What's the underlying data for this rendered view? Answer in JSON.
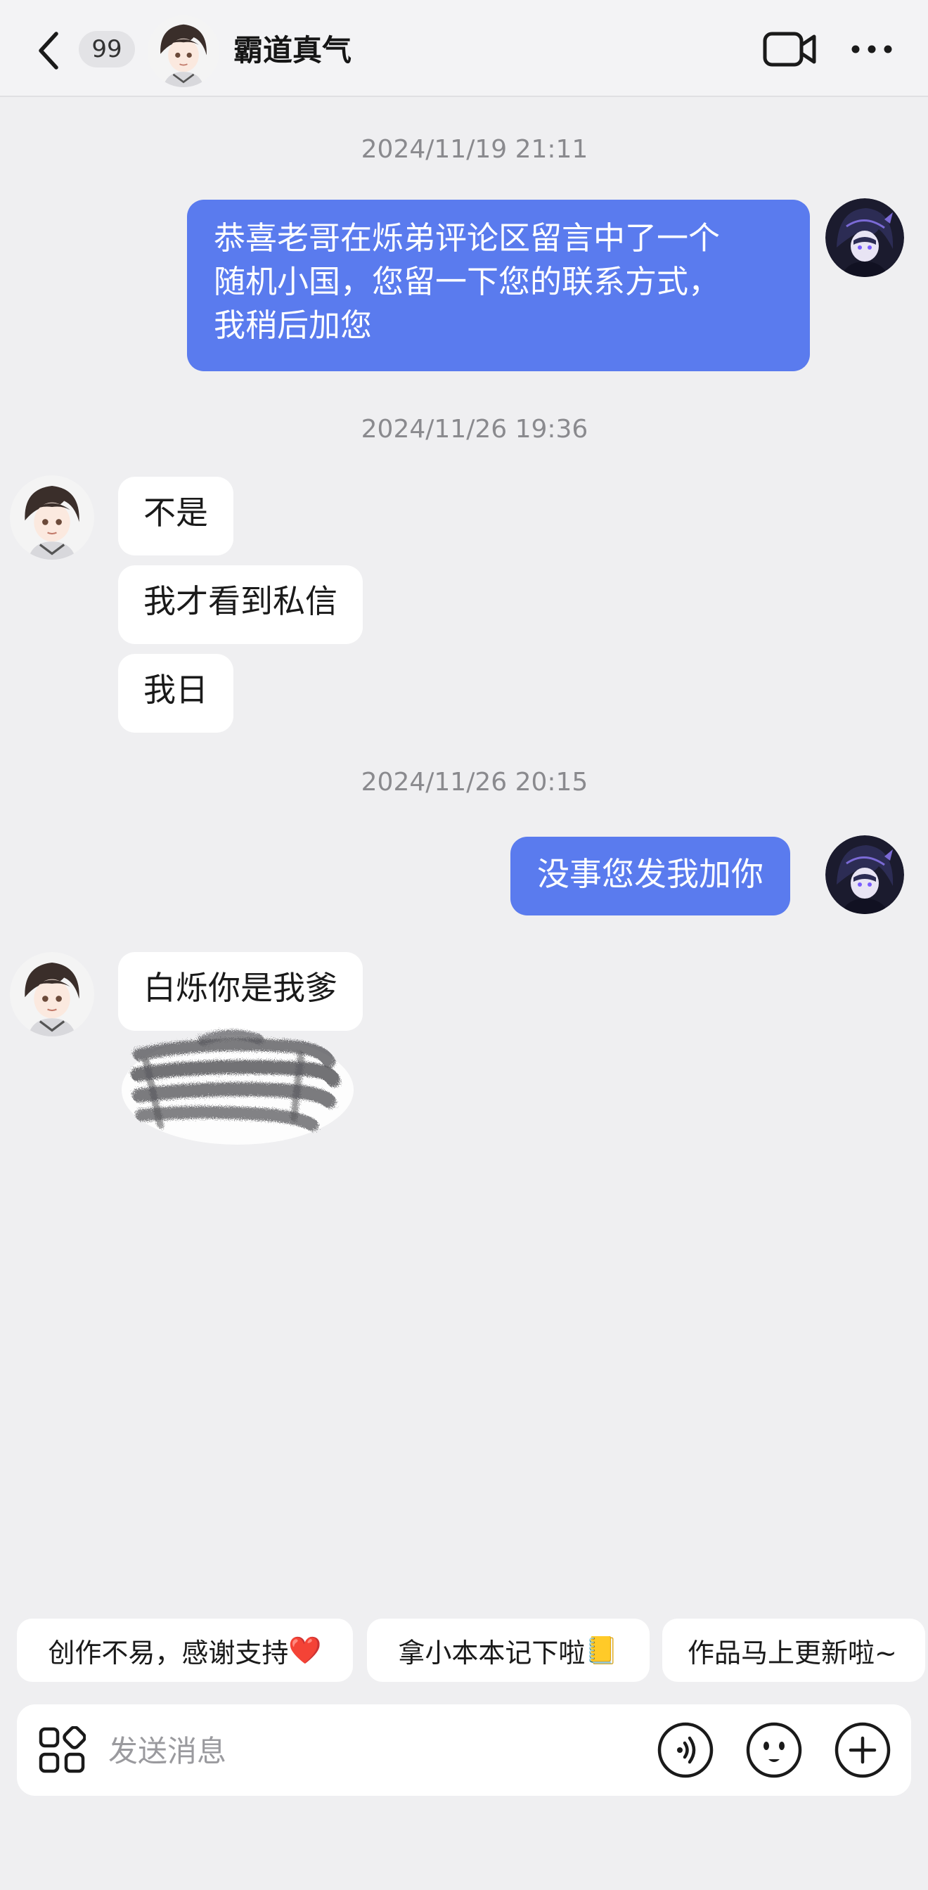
{
  "header": {
    "unread_count": "99",
    "title": "霸道真气"
  },
  "messages": [
    {
      "type": "timestamp",
      "text": "2024/11/19 21:11"
    },
    {
      "type": "outgoing",
      "lines": [
        "恭喜老哥在烁弟评论区留言中了一个",
        "随机小国，您留一下您的联系方式，",
        "我稍后加您"
      ]
    },
    {
      "type": "timestamp",
      "text": "2024/11/26 19:36"
    },
    {
      "type": "incoming",
      "text": "不是"
    },
    {
      "type": "incoming",
      "text": "我才看到私信"
    },
    {
      "type": "incoming",
      "text": "我日"
    },
    {
      "type": "timestamp",
      "text": "2024/11/26 20:15"
    },
    {
      "type": "outgoing",
      "text": "没事您发我加你"
    },
    {
      "type": "incoming",
      "text": "白烁你是我爹"
    }
  ],
  "quick_replies": [
    {
      "text": "创作不易，感谢支持",
      "emoji": "❤️"
    },
    {
      "text": "拿小本本记下啦",
      "emoji": "📒"
    },
    {
      "text": "作品马上更新啦~",
      "emoji": ""
    }
  ],
  "input": {
    "placeholder": "发送消息"
  },
  "icons": {
    "back": "chevron-left-icon",
    "video": "video-camera-icon",
    "more": "more-dots-icon",
    "apps": "apps-grid-icon",
    "voice": "voice-icon",
    "emoji": "emoji-icon",
    "plus": "plus-icon"
  },
  "colors": {
    "outgoing_bubble": "#5a7bee",
    "incoming_bubble": "#ffffff",
    "background": "#efeff1"
  }
}
